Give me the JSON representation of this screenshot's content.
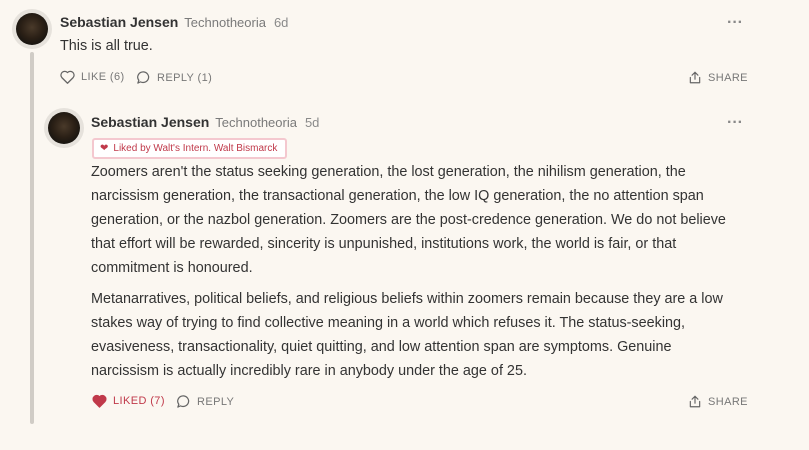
{
  "comment1": {
    "author": "Sebastian Jensen",
    "publication": "Technotheoria",
    "time": "6d",
    "body": "This is all true.",
    "like_label": "LIKE (6)",
    "reply_label": "REPLY (1)",
    "share_label": "SHARE"
  },
  "comment2": {
    "author": "Sebastian Jensen",
    "publication": "Technotheoria",
    "time": "5d",
    "badge": "Liked by Walt's Intern. Walt Bismarck",
    "paragraphs": [
      "Zoomers aren't the status seeking generation, the lost generation, the nihilism generation, the narcissism generation, the transactional generation, the low IQ generation, the no attention span generation, or the nazbol generation. Zoomers are the post-credence generation. We do not believe that effort will be rewarded, sincerity is unpunished, institutions work, the world is fair, or that commitment is honoured.",
      "Metanarratives, political beliefs, and religious beliefs within zoomers remain because they are a low stakes way of trying to find collective meaning in a world which refuses it. The status-seeking, evasiveness, transactionality, quiet quitting, and low attention span are symptoms. Genuine narcissism is actually incredibly rare in anybody under the age of 25."
    ],
    "like_label": "LIKED (7)",
    "reply_label": "REPLY",
    "share_label": "SHARE"
  },
  "colors": {
    "background": "#fbf7f1",
    "liked": "#c0394a",
    "thread_line": "#d0ccc6"
  },
  "icons": [
    "heart-outline-icon",
    "heart-filled-icon",
    "speech-bubble-icon",
    "share-icon",
    "more-options-icon"
  ]
}
